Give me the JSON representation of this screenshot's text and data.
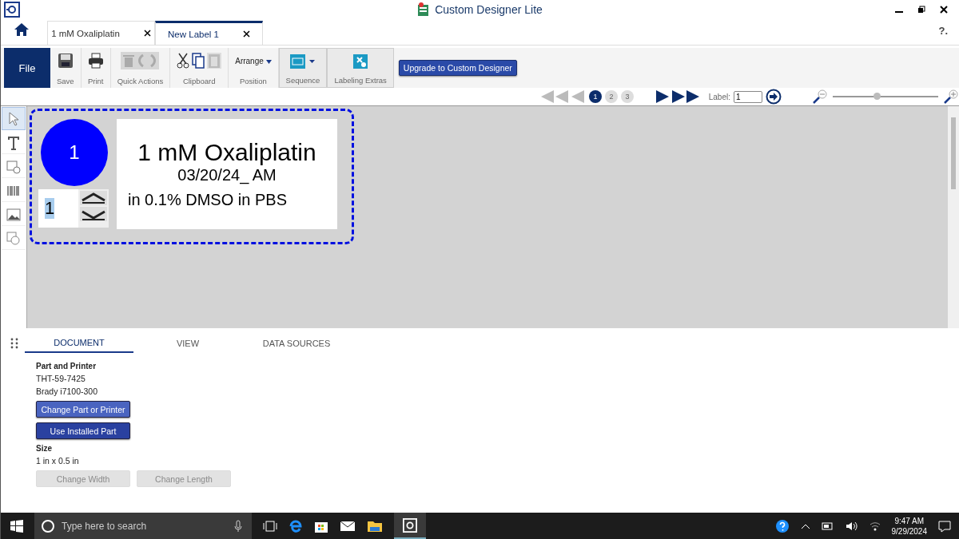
{
  "window": {
    "title": "Custom Designer Lite",
    "help": "?."
  },
  "tabs": [
    {
      "label": "1 mM Oxaliplatin",
      "selected": false
    },
    {
      "label": "New Label 1",
      "selected": true
    }
  ],
  "ribbon": {
    "file": "File",
    "groups": [
      {
        "kind": "save",
        "label": "Save"
      },
      {
        "kind": "print",
        "label": "Print"
      },
      {
        "kind": "quick",
        "label": "Quick Actions",
        "disabled": true
      },
      {
        "kind": "clipboard",
        "label": "Clipboard"
      },
      {
        "kind": "arrange",
        "label": "Position",
        "menu": "Arrange"
      },
      {
        "kind": "sequence",
        "label": "Sequence"
      },
      {
        "kind": "extras",
        "label": "Labeling Extras"
      }
    ],
    "upgrade": "Upgrade to Custom Designer"
  },
  "pager": {
    "pages": [
      {
        "label": "1",
        "selected": true
      },
      {
        "label": "2",
        "selected": false
      },
      {
        "label": "3",
        "selected": false
      }
    ],
    "label_caption": "Label:",
    "label_value": "1",
    "zoom": {
      "level": 0.42
    }
  },
  "tools": [
    {
      "kind": "pointer",
      "selected": true
    },
    {
      "kind": "text",
      "selected": false
    },
    {
      "kind": "datetime",
      "selected": false
    },
    {
      "kind": "barcode",
      "selected": false
    },
    {
      "kind": "image",
      "selected": false
    },
    {
      "kind": "shape",
      "selected": false
    }
  ],
  "label": {
    "badge": "1",
    "spinner_value": "1",
    "lines": [
      "1 mM Oxaliplatin",
      "03/20/24_ AM",
      "in 0.1% DMSO in PBS"
    ]
  },
  "panel": {
    "tabs": [
      {
        "label": "DOCUMENT",
        "selected": true
      },
      {
        "label": "VIEW",
        "selected": false
      },
      {
        "label": "DATA SOURCES",
        "selected": false
      }
    ],
    "sections": [
      {
        "heading": "Part and Printer",
        "lines": [
          "THT-59-7425",
          "Brady i7100-300"
        ],
        "buttons": [
          {
            "label": "Change Part or Printer",
            "disabled": false,
            "kind": "light"
          },
          {
            "label": "Use Installed Part",
            "disabled": false,
            "kind": "dark"
          }
        ]
      },
      {
        "heading": "Size",
        "lines": [
          "1 in x 0.5 in"
        ],
        "buttons": [
          {
            "label": "Change Width",
            "disabled": true,
            "kind": "light"
          },
          {
            "label": "Change Length",
            "disabled": true,
            "kind": "light"
          }
        ]
      }
    ]
  },
  "taskbar": {
    "search_placeholder": "Type here to search",
    "time": "9:47 AM",
    "date": "9/29/2024"
  }
}
